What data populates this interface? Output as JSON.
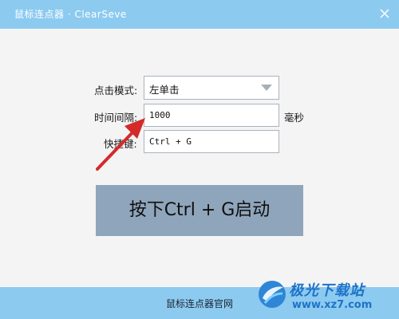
{
  "window": {
    "title": "鼠标连点器 · ClearSeve",
    "close_icon": "close-icon"
  },
  "form": {
    "click_mode": {
      "label": "点击模式:",
      "value": "左单击"
    },
    "interval": {
      "label": "时间间隔:",
      "value": "1000",
      "unit": "毫秒"
    },
    "hotkey": {
      "label": "快捷键:",
      "value": "Ctrl + G"
    }
  },
  "start_button": {
    "label": "按下Ctrl + G启动"
  },
  "footer": {
    "link": "鼠标连点器官网"
  },
  "watermark": {
    "brand": "极光下载站",
    "url": "www.xz7.com"
  },
  "colors": {
    "titlebar": "#8ccaf0",
    "button": "#8fa5bb",
    "annotation_arrow": "#d42a2a"
  }
}
